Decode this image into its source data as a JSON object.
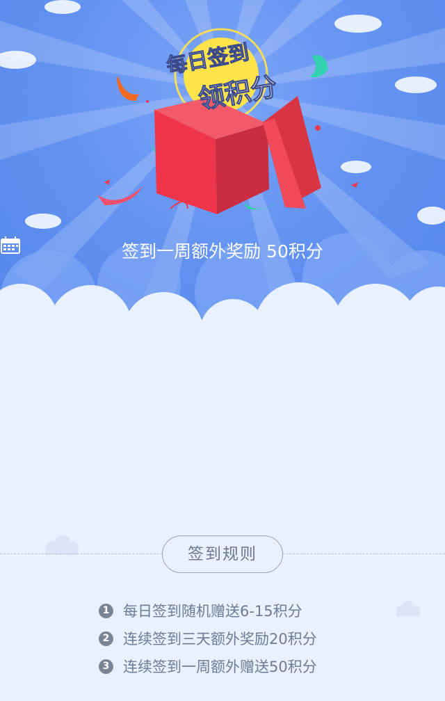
{
  "hero": {
    "title_line1": "每日签到",
    "title_line2": "领积分",
    "weekly_bonus": "签到一周额外奖励 50积分",
    "calendar_icon": "calendar-icon"
  },
  "rules": {
    "title": "签到规则",
    "items": [
      {
        "num": "1",
        "text": "每日签到随机赠送6-15积分"
      },
      {
        "num": "2",
        "text": "连续签到三天额外奖励20积分"
      },
      {
        "num": "3",
        "text": "连续签到一周额外赠送50积分"
      }
    ]
  },
  "colors": {
    "sky": "#5f8ff0",
    "page_bg": "#e9f1fe",
    "box_red": "#e83a4f",
    "sun_yellow": "#ffe34a"
  }
}
